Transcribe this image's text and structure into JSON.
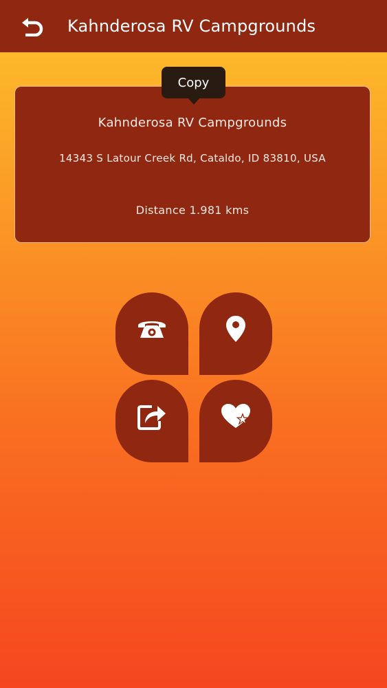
{
  "header": {
    "title": "Kahnderosa RV Campgrounds",
    "back_icon": "back-arrow-icon"
  },
  "tooltip": {
    "label": "Copy"
  },
  "place": {
    "name": "Kahnderosa RV Campgrounds",
    "address": "14343 S Latour Creek Rd, Cataldo, ID 83810, USA",
    "distance": "Distance 1.981 kms"
  },
  "actions": [
    {
      "name": "call",
      "icon": "telephone-icon"
    },
    {
      "name": "map",
      "icon": "map-pin-icon"
    },
    {
      "name": "share",
      "icon": "share-icon"
    },
    {
      "name": "favorite",
      "icon": "heart-star-icon"
    }
  ],
  "colors": {
    "primary": "#8f2711",
    "gradient_top": "#fcc22b",
    "gradient_bottom": "#f5461f",
    "tooltip_bg": "#2a1b12",
    "text": "#ffffff"
  }
}
